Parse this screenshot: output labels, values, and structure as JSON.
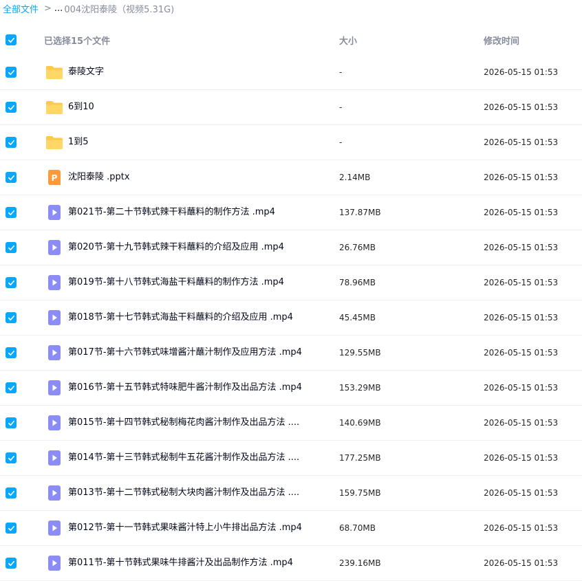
{
  "breadcrumb": {
    "root": "全部文件",
    "separator": ">",
    "ellipsis": "...",
    "current": "004沈阳泰陵（视频5.31G)"
  },
  "header": {
    "selected_label": "已选择15个文件",
    "size_label": "大小",
    "time_label": "修改时间"
  },
  "colors": {
    "accent": "#06a7ff",
    "folder": "#ffc94a",
    "video": "#8c8cf5",
    "ppt": "#ff9a3c"
  },
  "files": [
    {
      "type": "folder",
      "name": "泰陵文字",
      "size": "-",
      "time": "2026-05-15 01:53"
    },
    {
      "type": "folder",
      "name": "6到10",
      "size": "-",
      "time": "2026-05-15 01:53"
    },
    {
      "type": "folder",
      "name": "1到5",
      "size": "-",
      "time": "2026-05-15 01:53"
    },
    {
      "type": "ppt",
      "name": "沈阳泰陵 .pptx",
      "size": "2.14MB",
      "time": "2026-05-15 01:53"
    },
    {
      "type": "video",
      "name": "第021节-第二十节韩式辣干料蘸料的制作方法 .mp4",
      "size": "137.87MB",
      "time": "2026-05-15 01:53"
    },
    {
      "type": "video",
      "name": "第020节-第十九节韩式辣干料蘸料的介绍及应用 .mp4",
      "size": "26.76MB",
      "time": "2026-05-15 01:53"
    },
    {
      "type": "video",
      "name": "第019节-第十八节韩式海盐干料蘸料的制作方法 .mp4",
      "size": "78.96MB",
      "time": "2026-05-15 01:53"
    },
    {
      "type": "video",
      "name": "第018节-第十七节韩式海盐干料蘸料的介绍及应用 .mp4",
      "size": "45.45MB",
      "time": "2026-05-15 01:53"
    },
    {
      "type": "video",
      "name": "第017节-第十六节韩式味增酱汁蘸汁制作及应用方法 .mp4",
      "size": "129.55MB",
      "time": "2026-05-15 01:53"
    },
    {
      "type": "video",
      "name": "第016节-第十五节韩式特味肥牛酱汁制作及出品方法 .mp4",
      "size": "153.29MB",
      "time": "2026-05-15 01:53"
    },
    {
      "type": "video",
      "name": "第015节-第十四节韩式秘制梅花肉酱汁制作及出品方法 ....",
      "size": "140.69MB",
      "time": "2026-05-15 01:53"
    },
    {
      "type": "video",
      "name": "第014节-第十三节韩式秘制牛五花酱汁制作及出品方法 ....",
      "size": "177.25MB",
      "time": "2026-05-15 01:53"
    },
    {
      "type": "video",
      "name": "第013节-第十二节韩式秘制大块肉酱汁制作及出品方法 ....",
      "size": "159.75MB",
      "time": "2026-05-15 01:53"
    },
    {
      "type": "video",
      "name": "第012节-第十一节韩式果味酱汁特上小牛排出品方法 .mp4",
      "size": "68.70MB",
      "time": "2026-05-15 01:53"
    },
    {
      "type": "video",
      "name": "第011节-第十节韩式果味牛排酱汁及出品制作方法 .mp4",
      "size": "239.16MB",
      "time": "2026-05-15 01:53"
    }
  ]
}
